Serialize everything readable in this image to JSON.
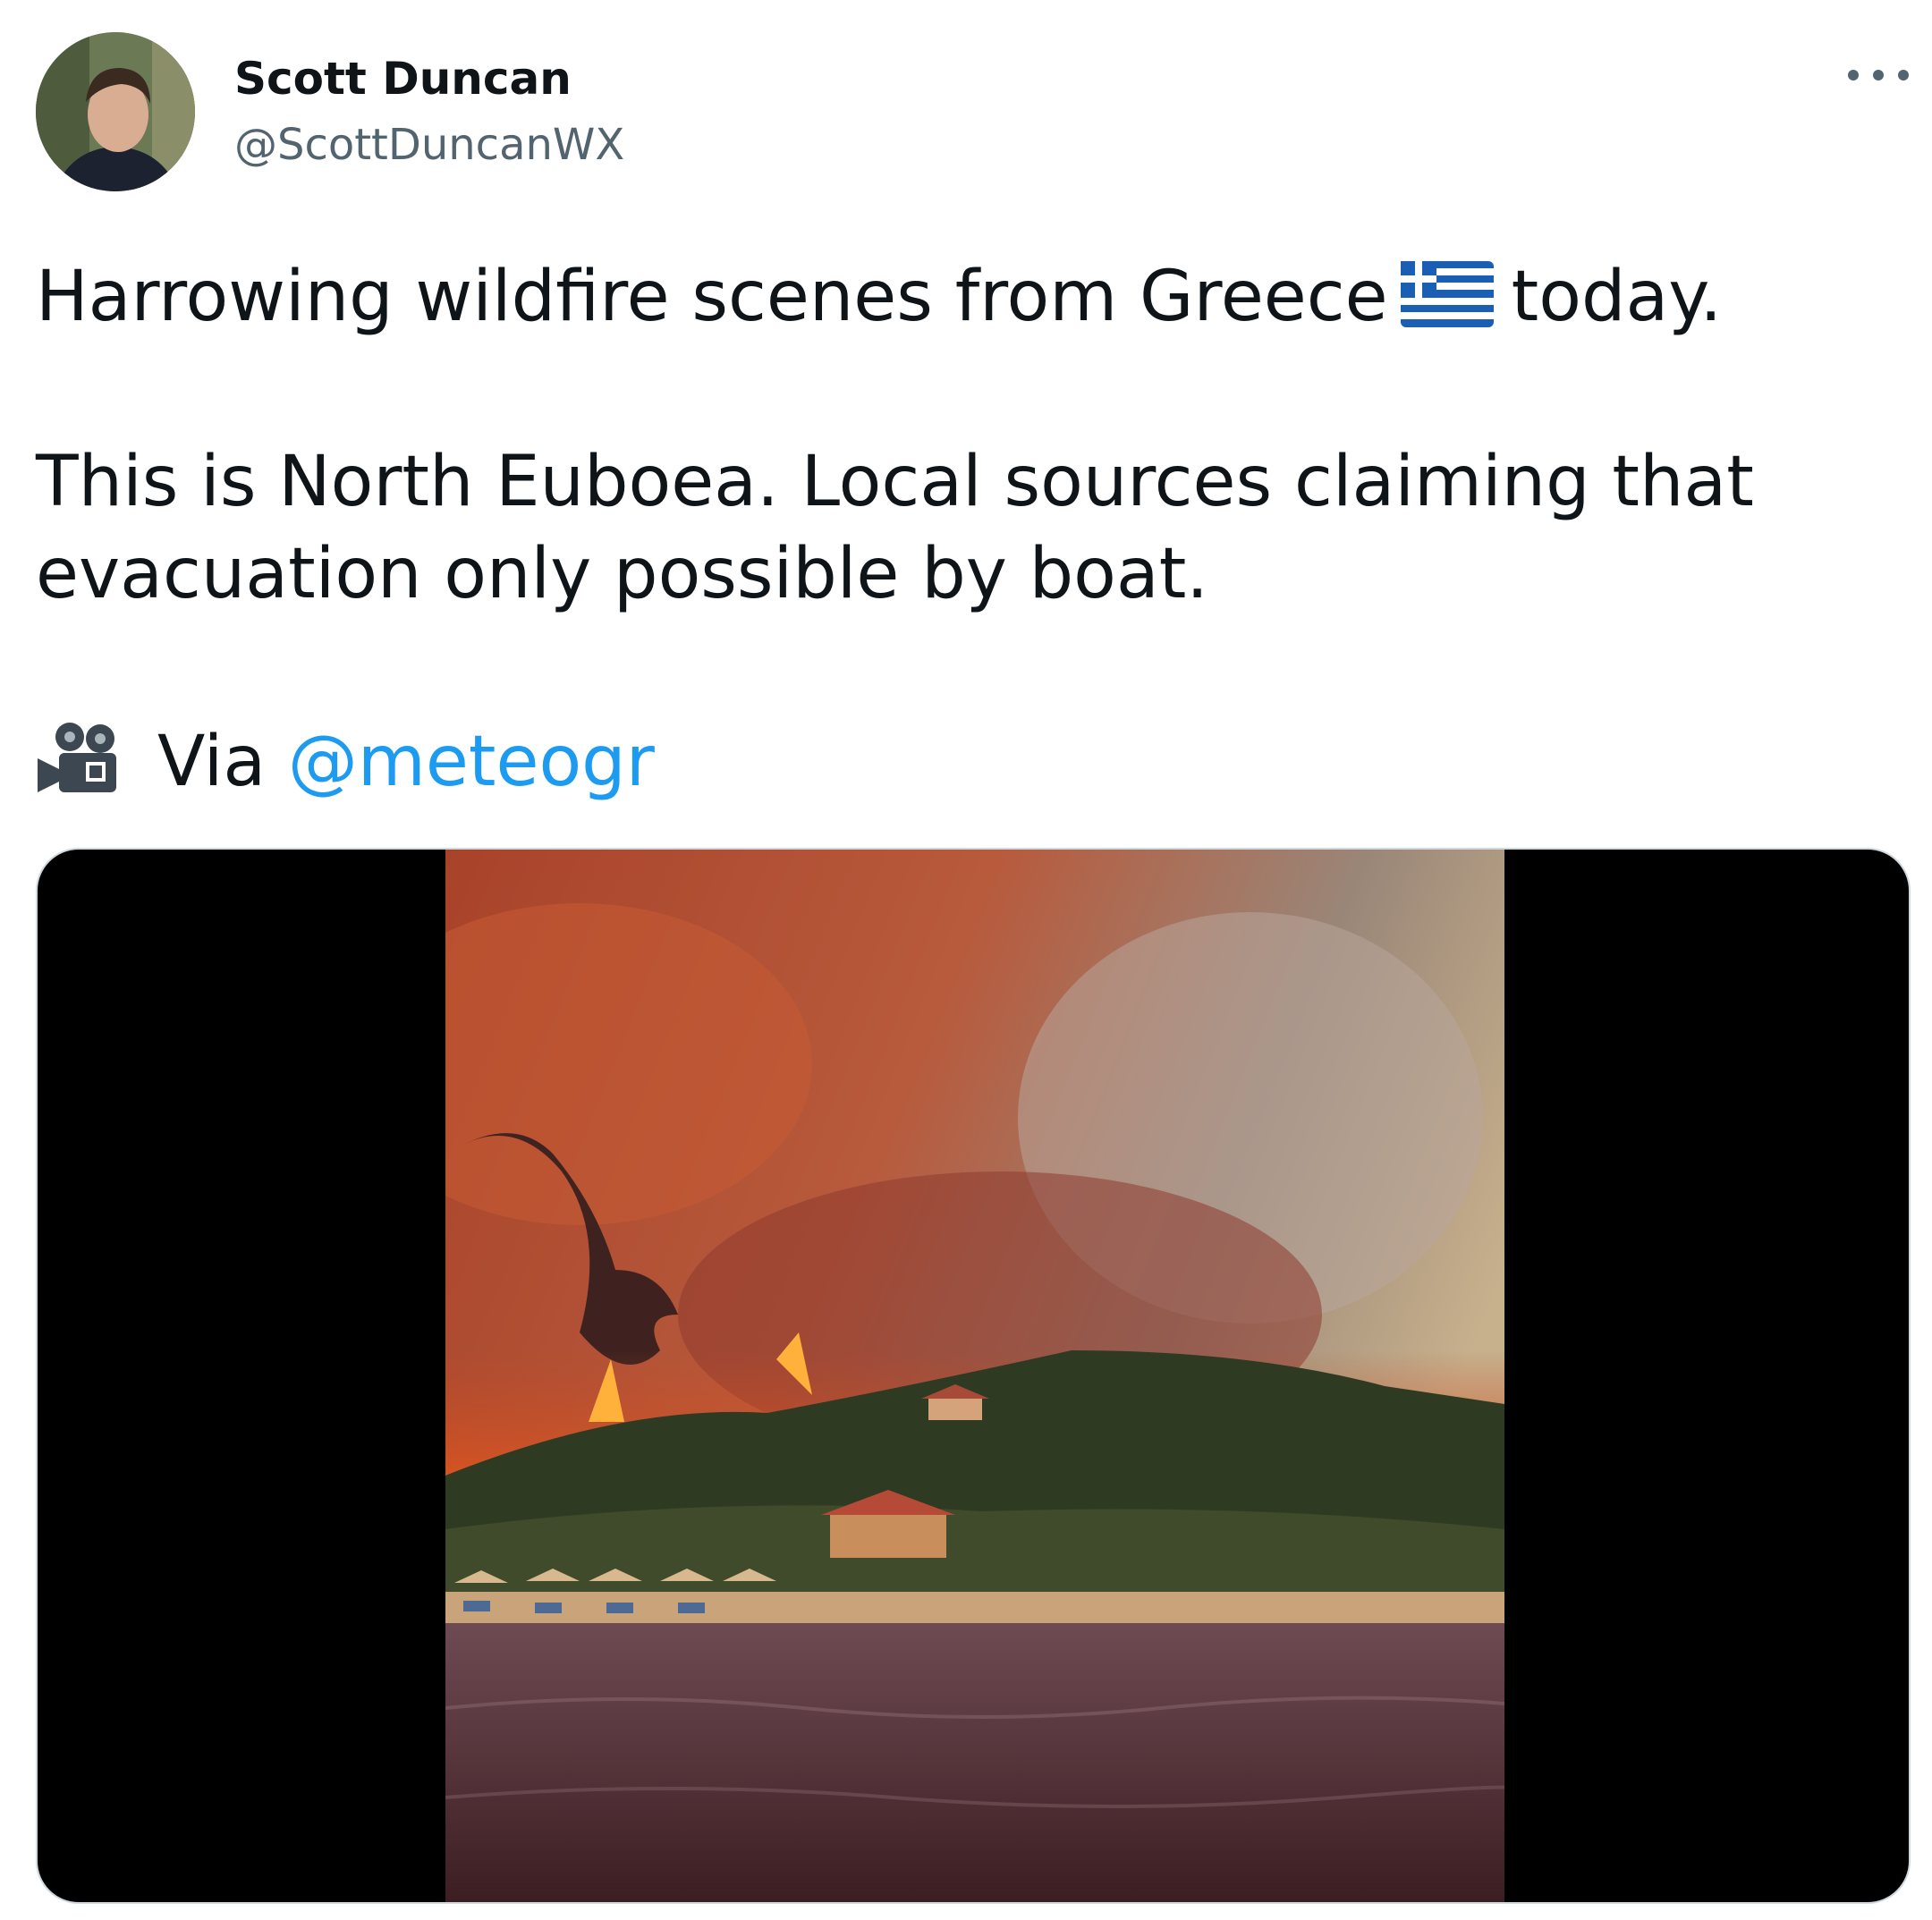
{
  "author": {
    "display_name": "Scott Duncan",
    "handle": "@ScottDuncanWX"
  },
  "tweet": {
    "line1_prefix": "Harrowing wildfire scenes from Greece",
    "line1_suffix": "today.",
    "line2": "This is North Euboea. Local sources claiming that",
    "line3": "evacuation only possible by boat.",
    "via_label": "Via",
    "mention": "@meteogr"
  },
  "icons": {
    "flag": "greece-flag-icon",
    "camera": "movie-camera-icon",
    "more": "more-options-icon"
  },
  "colors": {
    "text": "#0f1419",
    "secondary_text": "#536471",
    "link": "#1d9bf0",
    "media_background": "#000000"
  }
}
